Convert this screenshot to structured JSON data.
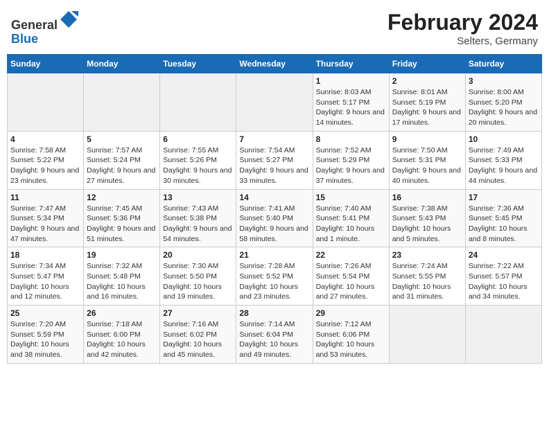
{
  "header": {
    "logo_line1": "General",
    "logo_line2": "Blue",
    "title": "February 2024",
    "subtitle": "Selters, Germany"
  },
  "weekdays": [
    "Sunday",
    "Monday",
    "Tuesday",
    "Wednesday",
    "Thursday",
    "Friday",
    "Saturday"
  ],
  "weeks": [
    [
      {
        "day": "",
        "sunrise": "",
        "sunset": "",
        "daylight": ""
      },
      {
        "day": "",
        "sunrise": "",
        "sunset": "",
        "daylight": ""
      },
      {
        "day": "",
        "sunrise": "",
        "sunset": "",
        "daylight": ""
      },
      {
        "day": "",
        "sunrise": "",
        "sunset": "",
        "daylight": ""
      },
      {
        "day": "1",
        "sunrise": "Sunrise: 8:03 AM",
        "sunset": "Sunset: 5:17 PM",
        "daylight": "Daylight: 9 hours and 14 minutes."
      },
      {
        "day": "2",
        "sunrise": "Sunrise: 8:01 AM",
        "sunset": "Sunset: 5:19 PM",
        "daylight": "Daylight: 9 hours and 17 minutes."
      },
      {
        "day": "3",
        "sunrise": "Sunrise: 8:00 AM",
        "sunset": "Sunset: 5:20 PM",
        "daylight": "Daylight: 9 hours and 20 minutes."
      }
    ],
    [
      {
        "day": "4",
        "sunrise": "Sunrise: 7:58 AM",
        "sunset": "Sunset: 5:22 PM",
        "daylight": "Daylight: 9 hours and 23 minutes."
      },
      {
        "day": "5",
        "sunrise": "Sunrise: 7:57 AM",
        "sunset": "Sunset: 5:24 PM",
        "daylight": "Daylight: 9 hours and 27 minutes."
      },
      {
        "day": "6",
        "sunrise": "Sunrise: 7:55 AM",
        "sunset": "Sunset: 5:26 PM",
        "daylight": "Daylight: 9 hours and 30 minutes."
      },
      {
        "day": "7",
        "sunrise": "Sunrise: 7:54 AM",
        "sunset": "Sunset: 5:27 PM",
        "daylight": "Daylight: 9 hours and 33 minutes."
      },
      {
        "day": "8",
        "sunrise": "Sunrise: 7:52 AM",
        "sunset": "Sunset: 5:29 PM",
        "daylight": "Daylight: 9 hours and 37 minutes."
      },
      {
        "day": "9",
        "sunrise": "Sunrise: 7:50 AM",
        "sunset": "Sunset: 5:31 PM",
        "daylight": "Daylight: 9 hours and 40 minutes."
      },
      {
        "day": "10",
        "sunrise": "Sunrise: 7:49 AM",
        "sunset": "Sunset: 5:33 PM",
        "daylight": "Daylight: 9 hours and 44 minutes."
      }
    ],
    [
      {
        "day": "11",
        "sunrise": "Sunrise: 7:47 AM",
        "sunset": "Sunset: 5:34 PM",
        "daylight": "Daylight: 9 hours and 47 minutes."
      },
      {
        "day": "12",
        "sunrise": "Sunrise: 7:45 AM",
        "sunset": "Sunset: 5:36 PM",
        "daylight": "Daylight: 9 hours and 51 minutes."
      },
      {
        "day": "13",
        "sunrise": "Sunrise: 7:43 AM",
        "sunset": "Sunset: 5:38 PM",
        "daylight": "Daylight: 9 hours and 54 minutes."
      },
      {
        "day": "14",
        "sunrise": "Sunrise: 7:41 AM",
        "sunset": "Sunset: 5:40 PM",
        "daylight": "Daylight: 9 hours and 58 minutes."
      },
      {
        "day": "15",
        "sunrise": "Sunrise: 7:40 AM",
        "sunset": "Sunset: 5:41 PM",
        "daylight": "Daylight: 10 hours and 1 minute."
      },
      {
        "day": "16",
        "sunrise": "Sunrise: 7:38 AM",
        "sunset": "Sunset: 5:43 PM",
        "daylight": "Daylight: 10 hours and 5 minutes."
      },
      {
        "day": "17",
        "sunrise": "Sunrise: 7:36 AM",
        "sunset": "Sunset: 5:45 PM",
        "daylight": "Daylight: 10 hours and 8 minutes."
      }
    ],
    [
      {
        "day": "18",
        "sunrise": "Sunrise: 7:34 AM",
        "sunset": "Sunset: 5:47 PM",
        "daylight": "Daylight: 10 hours and 12 minutes."
      },
      {
        "day": "19",
        "sunrise": "Sunrise: 7:32 AM",
        "sunset": "Sunset: 5:48 PM",
        "daylight": "Daylight: 10 hours and 16 minutes."
      },
      {
        "day": "20",
        "sunrise": "Sunrise: 7:30 AM",
        "sunset": "Sunset: 5:50 PM",
        "daylight": "Daylight: 10 hours and 19 minutes."
      },
      {
        "day": "21",
        "sunrise": "Sunrise: 7:28 AM",
        "sunset": "Sunset: 5:52 PM",
        "daylight": "Daylight: 10 hours and 23 minutes."
      },
      {
        "day": "22",
        "sunrise": "Sunrise: 7:26 AM",
        "sunset": "Sunset: 5:54 PM",
        "daylight": "Daylight: 10 hours and 27 minutes."
      },
      {
        "day": "23",
        "sunrise": "Sunrise: 7:24 AM",
        "sunset": "Sunset: 5:55 PM",
        "daylight": "Daylight: 10 hours and 31 minutes."
      },
      {
        "day": "24",
        "sunrise": "Sunrise: 7:22 AM",
        "sunset": "Sunset: 5:57 PM",
        "daylight": "Daylight: 10 hours and 34 minutes."
      }
    ],
    [
      {
        "day": "25",
        "sunrise": "Sunrise: 7:20 AM",
        "sunset": "Sunset: 5:59 PM",
        "daylight": "Daylight: 10 hours and 38 minutes."
      },
      {
        "day": "26",
        "sunrise": "Sunrise: 7:18 AM",
        "sunset": "Sunset: 6:00 PM",
        "daylight": "Daylight: 10 hours and 42 minutes."
      },
      {
        "day": "27",
        "sunrise": "Sunrise: 7:16 AM",
        "sunset": "Sunset: 6:02 PM",
        "daylight": "Daylight: 10 hours and 45 minutes."
      },
      {
        "day": "28",
        "sunrise": "Sunrise: 7:14 AM",
        "sunset": "Sunset: 6:04 PM",
        "daylight": "Daylight: 10 hours and 49 minutes."
      },
      {
        "day": "29",
        "sunrise": "Sunrise: 7:12 AM",
        "sunset": "Sunset: 6:06 PM",
        "daylight": "Daylight: 10 hours and 53 minutes."
      },
      {
        "day": "",
        "sunrise": "",
        "sunset": "",
        "daylight": ""
      },
      {
        "day": "",
        "sunrise": "",
        "sunset": "",
        "daylight": ""
      }
    ]
  ]
}
